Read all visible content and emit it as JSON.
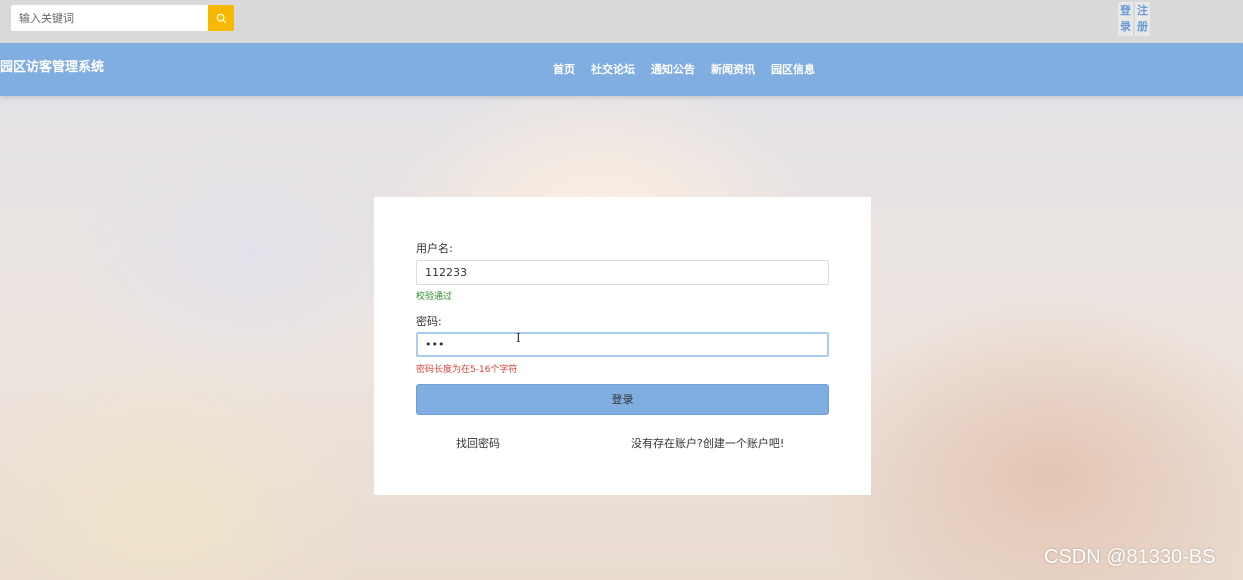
{
  "search": {
    "placeholder": "输入关键词",
    "icon": "search-icon"
  },
  "auth": {
    "login": "登录",
    "register": "注册"
  },
  "header": {
    "title": "园区访客管理系统",
    "nav": [
      "首页",
      "社交论坛",
      "通知公告",
      "新闻资讯",
      "园区信息"
    ]
  },
  "form": {
    "username_label": "用户名:",
    "username_value": "112233",
    "username_hint": "校验通过",
    "password_label": "密码:",
    "password_value": "•••",
    "password_hint": "密码长度为在5-16个字符",
    "submit_label": "登录",
    "forgot_link": "找回密码",
    "register_link": "没有存在账户?创建一个账户吧!"
  },
  "watermark": "CSDN @81330-BS",
  "colors": {
    "accent": "#80aee0",
    "search_button": "#f9b800",
    "success": "#2a8a2a",
    "error": "#e0403a"
  }
}
